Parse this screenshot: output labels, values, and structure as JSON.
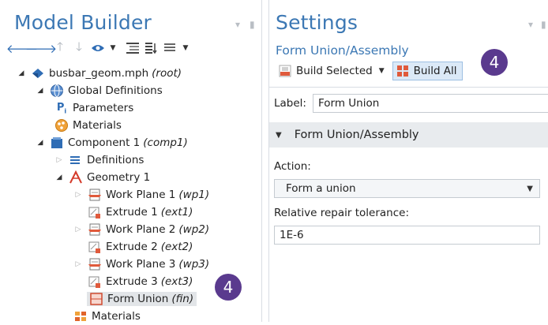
{
  "model_builder": {
    "title": "Model Builder",
    "tree": [
      {
        "label": "busbar_geom.mph",
        "tag": "(root)"
      },
      {
        "label": "Global Definitions",
        "tag": ""
      },
      {
        "label": "Parameters",
        "tag": ""
      },
      {
        "label": "Materials",
        "tag": ""
      },
      {
        "label": "Component 1",
        "tag": "(comp1)"
      },
      {
        "label": "Definitions",
        "tag": ""
      },
      {
        "label": "Geometry 1",
        "tag": ""
      },
      {
        "label": "Work Plane 1",
        "tag": "(wp1)"
      },
      {
        "label": "Extrude 1",
        "tag": "(ext1)"
      },
      {
        "label": "Work Plane 2",
        "tag": "(wp2)"
      },
      {
        "label": "Extrude 2",
        "tag": "(ext2)"
      },
      {
        "label": "Work Plane 3",
        "tag": "(wp3)"
      },
      {
        "label": "Extrude 3",
        "tag": "(ext3)"
      },
      {
        "label": "Form Union",
        "tag": "(fin)"
      },
      {
        "label": "Materials",
        "tag": ""
      }
    ],
    "badge": "4",
    "icons": [
      "arrow-left-icon",
      "arrow-right-icon",
      "arrow-up-icon",
      "arrow-down-icon",
      "show-icon",
      "expand-icon",
      "collapse-icon",
      "list-icon"
    ]
  },
  "settings": {
    "title": "Settings",
    "subtitle": "Form Union/Assembly",
    "build_selected": "Build Selected",
    "build_all": "Build All",
    "badge": "4",
    "label_caption": "Label:",
    "label_value": "Form Union",
    "section_title": "Form Union/Assembly",
    "action_label": "Action:",
    "action_value": "Form a union",
    "tolerance_label": "Relative repair tolerance:",
    "tolerance_value": "1E-6"
  },
  "colors": {
    "title_blue": "#3c78b4",
    "badge_purple": "#5a3a8e",
    "selection_gray": "#e2e5e8",
    "active_button": "#dbe9f7"
  }
}
